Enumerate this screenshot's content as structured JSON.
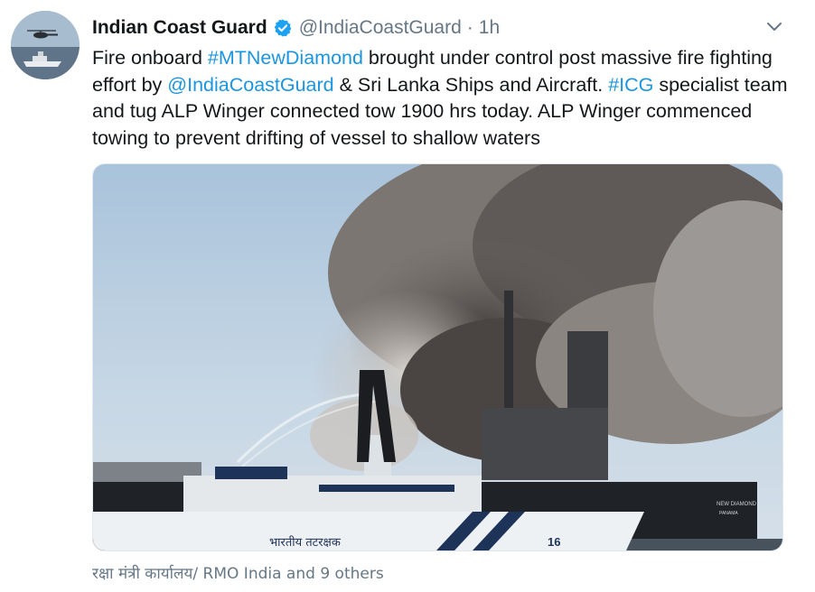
{
  "tweet": {
    "author_name": "Indian Coast Guard",
    "handle": "@IndiaCoastGuard",
    "separator": "·",
    "time": "1h",
    "text_parts": [
      {
        "text": "Fire onboard ",
        "link": false
      },
      {
        "text": "#MTNewDiamond",
        "link": true
      },
      {
        "text": " brought under control post massive fire fighting effort by ",
        "link": false
      },
      {
        "text": "@IndiaCoastGuard",
        "link": true
      },
      {
        "text": " & Sri Lanka Ships and Aircraft. ",
        "link": false
      },
      {
        "text": "#ICG",
        "link": true
      },
      {
        "text": " specialist team and tug ALP Winger connected tow 1900 hrs today. ALP Winger commenced towing to prevent drifting of vessel to shallow waters",
        "link": false
      }
    ],
    "social_proof": "रक्षा मंत्री कार्यालय/ RMO India and 9 others"
  },
  "media": {
    "ship_hull_text": "भारतीय तटरक्षक",
    "ship_number": "16",
    "tanker_name": "NEW DIAMOND",
    "tanker_port": "PANAMA"
  },
  "colors": {
    "link": "#1b95e0",
    "verified": "#1da1f2",
    "secondary_text": "#657786"
  },
  "icons": {
    "verified": "verified-badge-icon",
    "menu": "chevron-down-icon"
  }
}
